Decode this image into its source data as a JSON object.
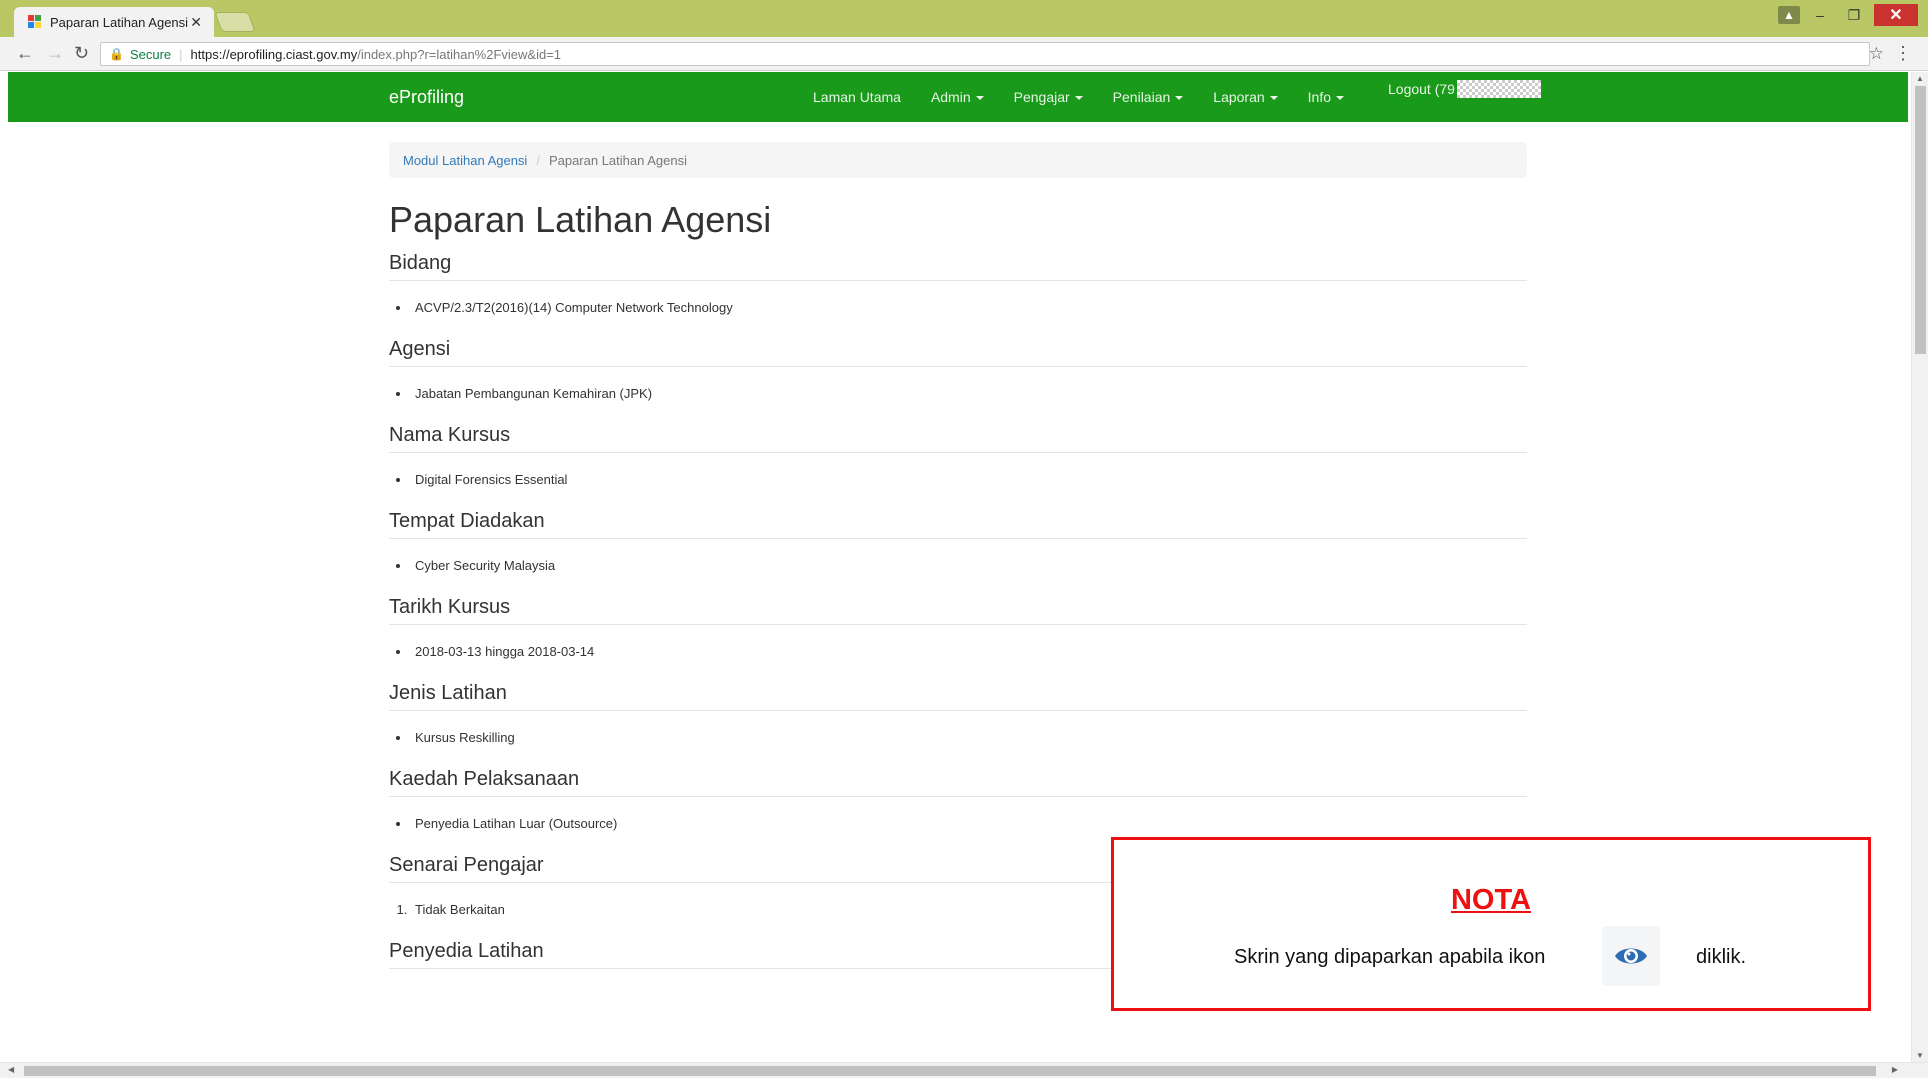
{
  "browser": {
    "tab_title": "Paparan Latihan Agensi",
    "tab_close": "✕",
    "secure_label": "Secure",
    "url_host": "https://eprofiling.ciast.gov.my",
    "url_path": "/index.php?r=latihan%2Fview&id=1",
    "favicon_colors": [
      "#e53935",
      "#43a047",
      "#1e88e5",
      "#fdd835"
    ]
  },
  "navbar": {
    "brand": "eProfiling",
    "items": [
      {
        "label": "Laman Utama",
        "dropdown": false
      },
      {
        "label": "Admin",
        "dropdown": true
      },
      {
        "label": "Pengajar",
        "dropdown": true
      },
      {
        "label": "Penilaian",
        "dropdown": true
      },
      {
        "label": "Laporan",
        "dropdown": true
      },
      {
        "label": "Info",
        "dropdown": true
      }
    ],
    "logout": "Logout (79",
    "color": "#1a9a1a"
  },
  "breadcrumb": {
    "parent": "Modul Latihan Agensi",
    "current": "Paparan Latihan Agensi"
  },
  "page_title": "Paparan Latihan Agensi",
  "sections": [
    {
      "heading": "Bidang",
      "items": [
        "ACVP/2.3/T2(2016)(14) Computer Network Technology"
      ]
    },
    {
      "heading": "Agensi",
      "items": [
        "Jabatan Pembangunan Kemahiran (JPK)"
      ]
    },
    {
      "heading": "Nama Kursus",
      "items": [
        "Digital Forensics Essential"
      ]
    },
    {
      "heading": "Tempat Diadakan",
      "items": [
        "Cyber Security Malaysia"
      ]
    },
    {
      "heading": "Tarikh Kursus",
      "items": [
        "2018-03-13 hingga 2018-03-14"
      ]
    },
    {
      "heading": "Jenis Latihan",
      "items": [
        "Kursus Reskilling"
      ]
    },
    {
      "heading": "Kaedah Pelaksanaan",
      "items": [
        "Penyedia Latihan Luar (Outsource)"
      ]
    },
    {
      "heading": "Senarai Pengajar",
      "items": [
        "Tidak Berkaitan"
      ],
      "ordered": true
    },
    {
      "heading": "Penyedia Latihan",
      "items": []
    }
  ],
  "note": {
    "title": "NOTA",
    "text_before": "Skrin yang dipaparkan apabila ikon",
    "icon": "eye-icon",
    "text_after": "diklik.",
    "border_color": "#ee1111"
  }
}
